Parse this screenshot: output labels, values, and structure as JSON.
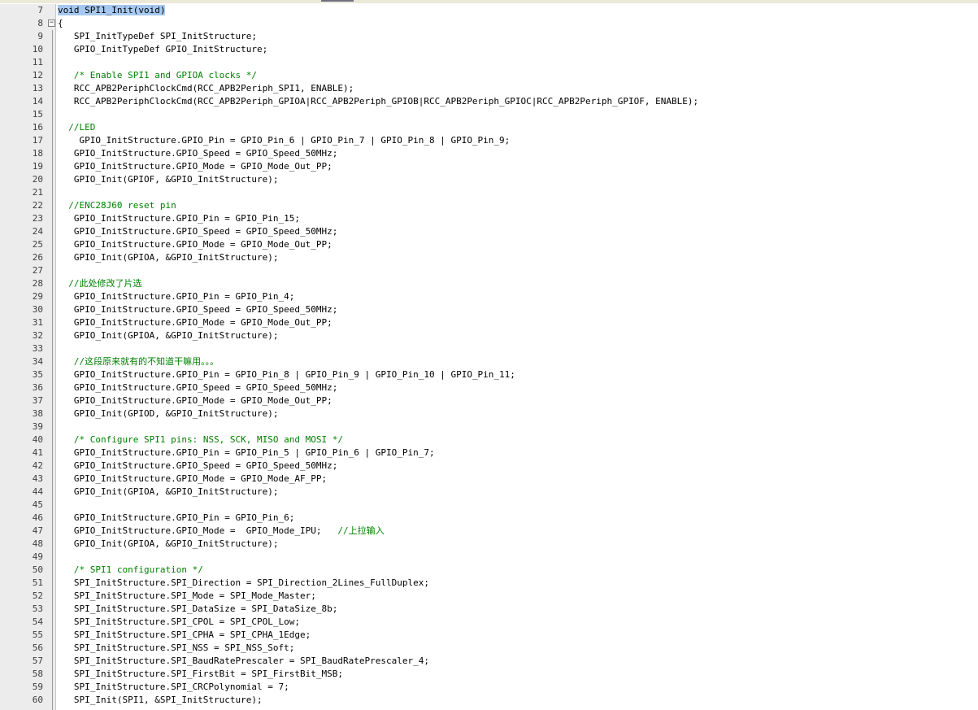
{
  "editor": {
    "fold_symbol": "−",
    "colors": {
      "code": "#000000",
      "comment": "#008000",
      "selection": "#a6c8f0",
      "gutter": "#ececec"
    },
    "lines": [
      {
        "n": "7",
        "code": "void SPI1_Init(void)",
        "selected": true
      },
      {
        "n": "8",
        "code": "{",
        "fold": true
      },
      {
        "n": "9",
        "code": "   SPI_InitTypeDef SPI_InitStructure;"
      },
      {
        "n": "10",
        "code": "   GPIO_InitTypeDef GPIO_InitStructure;"
      },
      {
        "n": "11",
        "code": ""
      },
      {
        "n": "12",
        "code": "   ",
        "comment": "/* Enable SPI1 and GPIOA clocks */"
      },
      {
        "n": "13",
        "code": "   RCC_APB2PeriphClockCmd(RCC_APB2Periph_SPI1, ENABLE);"
      },
      {
        "n": "14",
        "code": "   RCC_APB2PeriphClockCmd(RCC_APB2Periph_GPIOA|RCC_APB2Periph_GPIOB|RCC_APB2Periph_GPIOC|RCC_APB2Periph_GPIOF, ENABLE);"
      },
      {
        "n": "15",
        "code": ""
      },
      {
        "n": "16",
        "code": "  ",
        "comment": "//LED"
      },
      {
        "n": "17",
        "code": "    GPIO_InitStructure.GPIO_Pin = GPIO_Pin_6 | GPIO_Pin_7 | GPIO_Pin_8 | GPIO_Pin_9;"
      },
      {
        "n": "18",
        "code": "   GPIO_InitStructure.GPIO_Speed = GPIO_Speed_50MHz;"
      },
      {
        "n": "19",
        "code": "   GPIO_InitStructure.GPIO_Mode = GPIO_Mode_Out_PP;"
      },
      {
        "n": "20",
        "code": "   GPIO_Init(GPIOF, &GPIO_InitStructure);"
      },
      {
        "n": "21",
        "code": ""
      },
      {
        "n": "22",
        "code": "  ",
        "comment": "//ENC28J60 reset pin"
      },
      {
        "n": "23",
        "code": "   GPIO_InitStructure.GPIO_Pin = GPIO_Pin_15;"
      },
      {
        "n": "24",
        "code": "   GPIO_InitStructure.GPIO_Speed = GPIO_Speed_50MHz;"
      },
      {
        "n": "25",
        "code": "   GPIO_InitStructure.GPIO_Mode = GPIO_Mode_Out_PP;"
      },
      {
        "n": "26",
        "code": "   GPIO_Init(GPIOA, &GPIO_InitStructure);"
      },
      {
        "n": "27",
        "code": ""
      },
      {
        "n": "28",
        "code": "  ",
        "comment": "//此处修改了片选"
      },
      {
        "n": "29",
        "code": "   GPIO_InitStructure.GPIO_Pin = GPIO_Pin_4;"
      },
      {
        "n": "30",
        "code": "   GPIO_InitStructure.GPIO_Speed = GPIO_Speed_50MHz;"
      },
      {
        "n": "31",
        "code": "   GPIO_InitStructure.GPIO_Mode = GPIO_Mode_Out_PP;"
      },
      {
        "n": "32",
        "code": "   GPIO_Init(GPIOA, &GPIO_InitStructure);"
      },
      {
        "n": "33",
        "code": ""
      },
      {
        "n": "34",
        "code": "   ",
        "comment": "//这段原来就有的不知道干嘛用。。。"
      },
      {
        "n": "35",
        "code": "   GPIO_InitStructure.GPIO_Pin = GPIO_Pin_8 | GPIO_Pin_9 | GPIO_Pin_10 | GPIO_Pin_11;"
      },
      {
        "n": "36",
        "code": "   GPIO_InitStructure.GPIO_Speed = GPIO_Speed_50MHz;"
      },
      {
        "n": "37",
        "code": "   GPIO_InitStructure.GPIO_Mode = GPIO_Mode_Out_PP;"
      },
      {
        "n": "38",
        "code": "   GPIO_Init(GPIOD, &GPIO_InitStructure);"
      },
      {
        "n": "39",
        "code": ""
      },
      {
        "n": "40",
        "code": "   ",
        "comment": "/* Configure SPI1 pins: NSS, SCK, MISO and MOSI */"
      },
      {
        "n": "41",
        "code": "   GPIO_InitStructure.GPIO_Pin = GPIO_Pin_5 | GPIO_Pin_6 | GPIO_Pin_7;"
      },
      {
        "n": "42",
        "code": "   GPIO_InitStructure.GPIO_Speed = GPIO_Speed_50MHz;"
      },
      {
        "n": "43",
        "code": "   GPIO_InitStructure.GPIO_Mode = GPIO_Mode_AF_PP;"
      },
      {
        "n": "44",
        "code": "   GPIO_Init(GPIOA, &GPIO_InitStructure);"
      },
      {
        "n": "45",
        "code": ""
      },
      {
        "n": "46",
        "code": "   GPIO_InitStructure.GPIO_Pin = GPIO_Pin_6;"
      },
      {
        "n": "47",
        "code": "   GPIO_InitStructure.GPIO_Mode =  GPIO_Mode_IPU;   ",
        "comment": "//上拉输入"
      },
      {
        "n": "48",
        "code": "   GPIO_Init(GPIOA, &GPIO_InitStructure);"
      },
      {
        "n": "49",
        "code": ""
      },
      {
        "n": "50",
        "code": "   ",
        "comment": "/* SPI1 configuration */"
      },
      {
        "n": "51",
        "code": "   SPI_InitStructure.SPI_Direction = SPI_Direction_2Lines_FullDuplex;"
      },
      {
        "n": "52",
        "code": "   SPI_InitStructure.SPI_Mode = SPI_Mode_Master;"
      },
      {
        "n": "53",
        "code": "   SPI_InitStructure.SPI_DataSize = SPI_DataSize_8b;"
      },
      {
        "n": "54",
        "code": "   SPI_InitStructure.SPI_CPOL = SPI_CPOL_Low;"
      },
      {
        "n": "55",
        "code": "   SPI_InitStructure.SPI_CPHA = SPI_CPHA_1Edge;"
      },
      {
        "n": "56",
        "code": "   SPI_InitStructure.SPI_NSS = SPI_NSS_Soft;"
      },
      {
        "n": "57",
        "code": "   SPI_InitStructure.SPI_BaudRatePrescaler = SPI_BaudRatePrescaler_4;"
      },
      {
        "n": "58",
        "code": "   SPI_InitStructure.SPI_FirstBit = SPI_FirstBit_MSB;"
      },
      {
        "n": "59",
        "code": "   SPI_InitStructure.SPI_CRCPolynomial = 7;"
      },
      {
        "n": "60",
        "code": "   SPI_Init(SPI1, &SPI_InitStructure);"
      }
    ]
  }
}
